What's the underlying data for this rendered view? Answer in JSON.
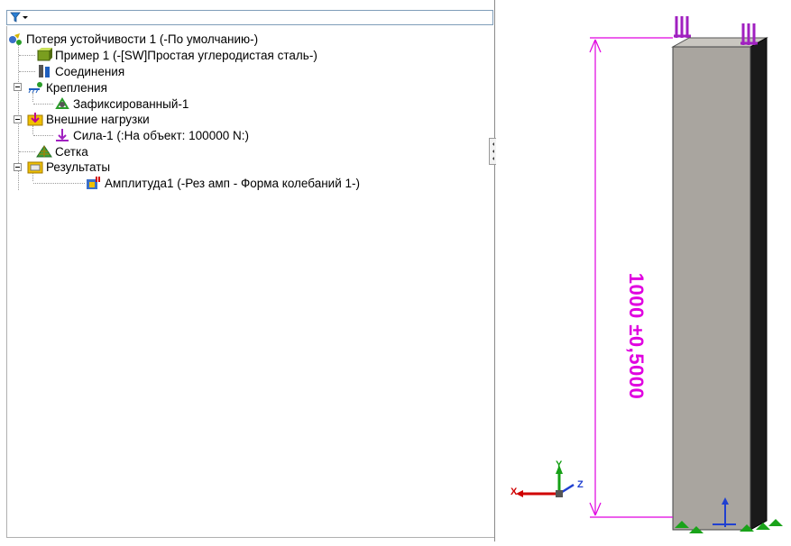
{
  "tree": {
    "filter_icon": "filter-icon",
    "root": {
      "label": "Потеря устойчивости 1 (-По умолчанию-)",
      "icon": "study-icon"
    },
    "items": [
      {
        "label": "Пример 1 (-[SW]Простая углеродистая сталь-)",
        "icon": "part-icon"
      },
      {
        "label": "Соединения",
        "icon": "connections-icon"
      },
      {
        "label": "Крепления",
        "icon": "fixtures-icon"
      },
      {
        "label": "Зафиксированный-1",
        "icon": "fixed-icon"
      },
      {
        "label": "Внешние нагрузки",
        "icon": "loads-icon"
      },
      {
        "label": "Сила-1 (:На объект: 100000 N:)",
        "icon": "force-icon"
      },
      {
        "label": "Сетка",
        "icon": "mesh-icon"
      },
      {
        "label": "Результаты",
        "icon": "results-icon"
      },
      {
        "label": "Амплитуда1 (-Рез амп - Форма колебаний 1-)",
        "icon": "amplitude-icon"
      }
    ]
  },
  "viewport": {
    "dimension_text": "1000 ±0,5000",
    "dimension_color": "#e000e0",
    "triad": {
      "x": "X",
      "y": "Y",
      "z": "Z"
    },
    "beam_color": "#a9a59f",
    "load_color": "#a020c0",
    "fixture_color": "#1aa31a"
  }
}
